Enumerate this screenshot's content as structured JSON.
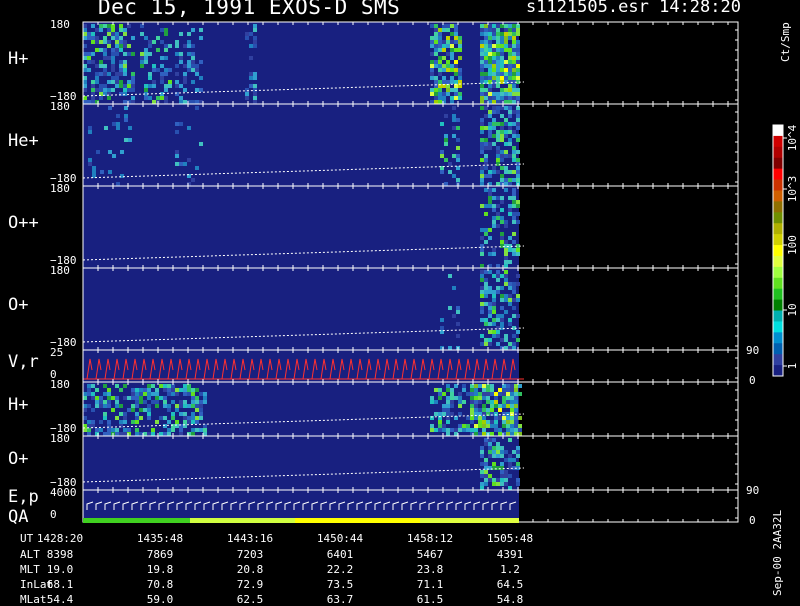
{
  "header": {
    "title": "Dec 15, 1991    EXOS-D SMS",
    "file": "s1121505.esr",
    "time": "14:28:20"
  },
  "chart_data": {
    "type": "heatmap",
    "title": "Dec 15, 1991    EXOS-D SMS",
    "colorbar": {
      "label": "Ct/Smp",
      "scale": "log",
      "ticks": [
        "10^4",
        "10^3",
        "100",
        "10",
        "1"
      ],
      "colors": [
        "#ffffff",
        "#d00000",
        "#b00000",
        "#800000",
        "#ff0000",
        "#cc3300",
        "#d06000",
        "#907000",
        "#709000",
        "#b0b000",
        "#d0d000",
        "#ffff00",
        "#e0ff40",
        "#a0ff40",
        "#60e020",
        "#20c020",
        "#008000",
        "#00b0b0",
        "#00e0e0",
        "#0090d0",
        "#0060b0",
        "#3040a0",
        "#182080"
      ]
    },
    "panels": [
      {
        "name": "H+",
        "tick_top": "180",
        "tick_bottom": "−180",
        "kind": "spectrogram"
      },
      {
        "name": "He+",
        "tick_top": "180",
        "tick_bottom": "−180",
        "kind": "spectrogram"
      },
      {
        "name": "O++",
        "tick_top": "180",
        "tick_bottom": "−180",
        "kind": "spectrogram"
      },
      {
        "name": "O+",
        "tick_top": "180",
        "tick_bottom": "−180",
        "kind": "spectrogram"
      },
      {
        "name": "V,r",
        "tick_top": "25",
        "tick_bottom": "0",
        "right_top": "90",
        "right_bottom": "0",
        "kind": "line"
      },
      {
        "name": "H+",
        "tick_top": "180",
        "tick_bottom": "−180",
        "kind": "spectrogram"
      },
      {
        "name": "O+",
        "tick_top": "180",
        "tick_bottom": "−180",
        "kind": "spectrogram"
      },
      {
        "name": "E,p",
        "name2": "QA",
        "tick_top": "4000",
        "tick_bottom": "0",
        "right_top": "90",
        "right_bottom": "0",
        "kind": "line"
      }
    ],
    "ephemeris": {
      "labels": [
        "UT",
        "ALT",
        "MLT",
        "InLat",
        "MLat"
      ],
      "columns": [
        [
          "1428:20",
          "8398",
          "19.0",
          "68.1",
          "54.4"
        ],
        [
          "1435:48",
          "7869",
          "19.8",
          "70.8",
          "59.0"
        ],
        [
          "1443:16",
          "7203",
          "20.8",
          "72.9",
          "62.5"
        ],
        [
          "1450:44",
          "6401",
          "22.2",
          "73.5",
          "63.7"
        ],
        [
          "1458:12",
          "5467",
          "23.8",
          "71.1",
          "61.5"
        ],
        [
          "1505:48",
          "4391",
          "1.2",
          "64.5",
          "54.8"
        ]
      ]
    }
  },
  "footer": {
    "code": "Sep-00  2AA32L"
  }
}
